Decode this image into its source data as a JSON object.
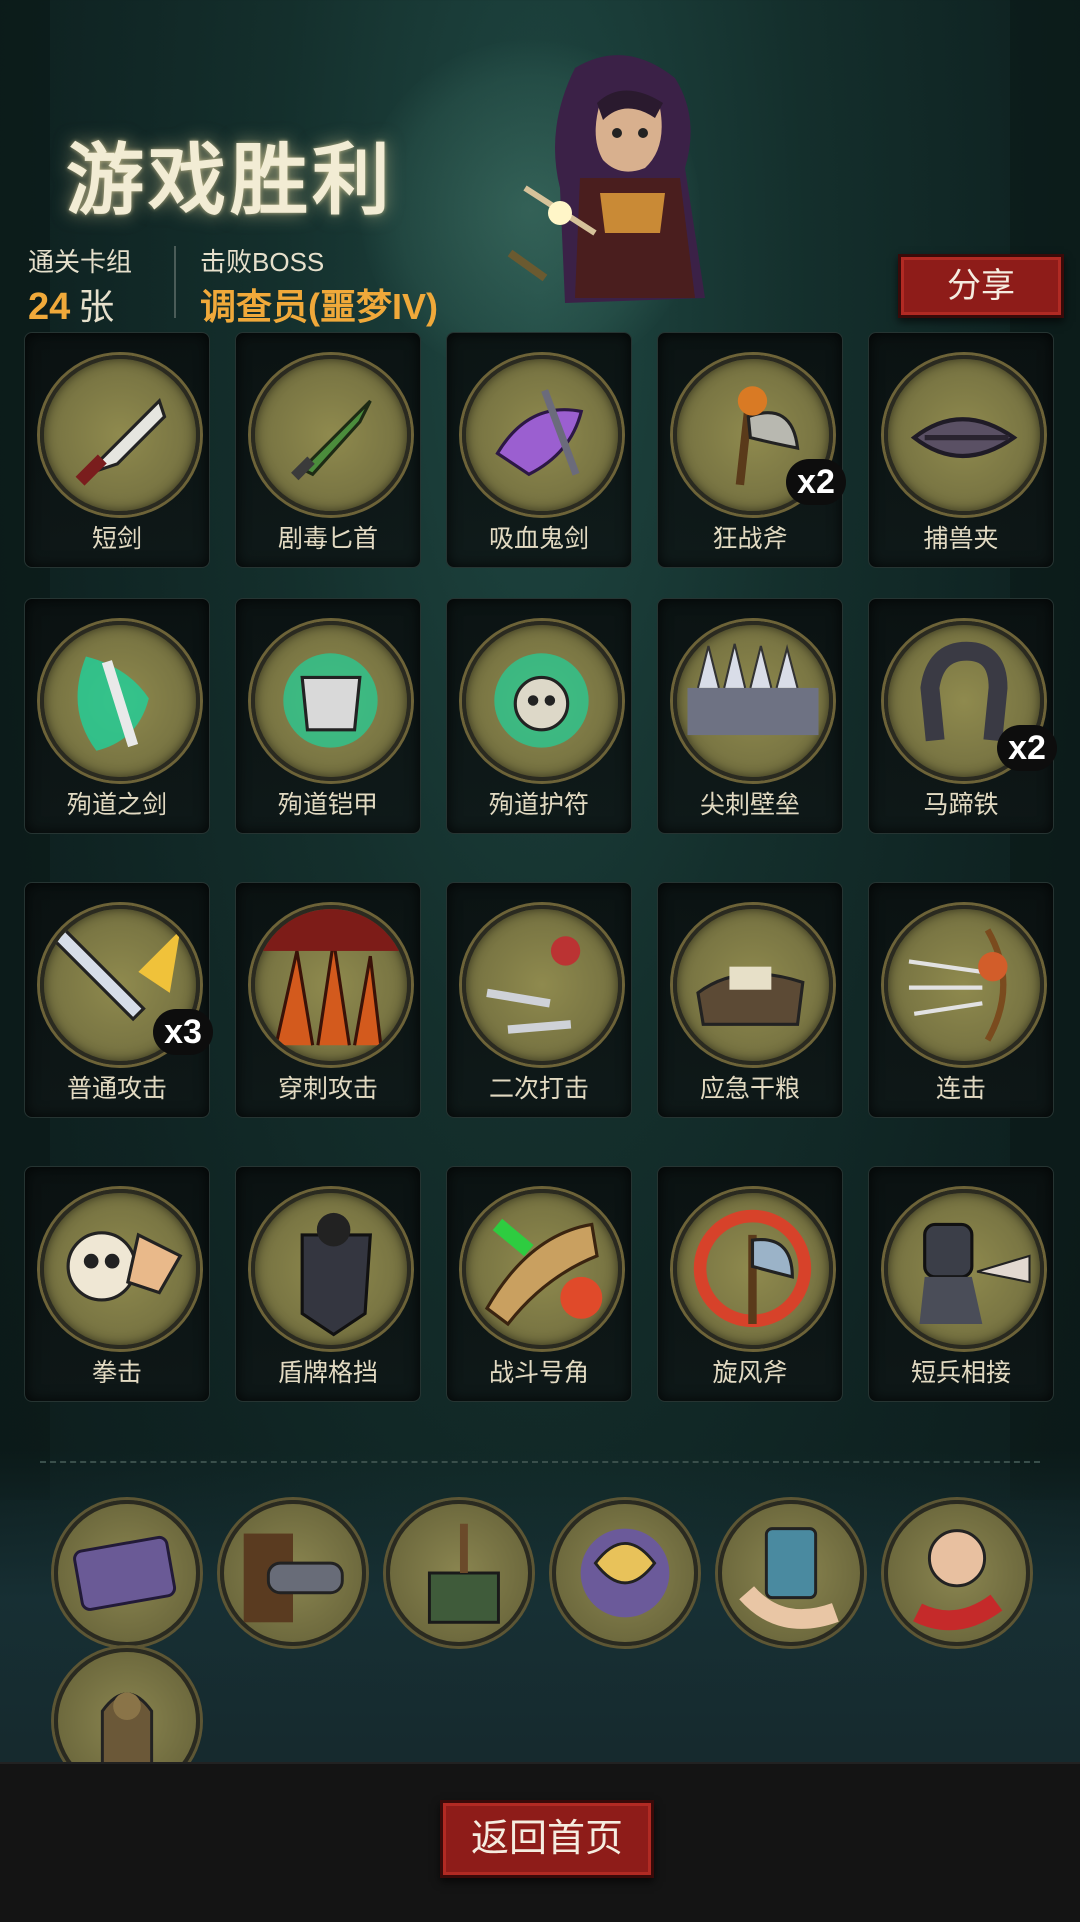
{
  "header": {
    "title": "游戏胜利",
    "cleared_deck_label": "通关卡组",
    "cleared_deck_count": "24",
    "cleared_deck_unit": "张",
    "defeated_boss_label": "击败BOSS",
    "defeated_boss_name": "调查员(噩梦IV)",
    "share_label": "分享"
  },
  "cards": [
    {
      "label": "短剑",
      "icon": "short-sword-icon",
      "count": ""
    },
    {
      "label": "剧毒匕首",
      "icon": "poison-dagger-icon",
      "count": ""
    },
    {
      "label": "吸血鬼剑",
      "icon": "vampire-sword-icon",
      "count": ""
    },
    {
      "label": "狂战斧",
      "icon": "berserker-axe-icon",
      "count": "x2"
    },
    {
      "label": "捕兽夹",
      "icon": "bear-trap-icon",
      "count": ""
    },
    {
      "label": "殉道之剑",
      "icon": "martyr-sword-icon",
      "count": ""
    },
    {
      "label": "殉道铠甲",
      "icon": "martyr-armor-icon",
      "count": ""
    },
    {
      "label": "殉道护符",
      "icon": "martyr-amulet-icon",
      "count": ""
    },
    {
      "label": "尖刺壁垒",
      "icon": "spike-wall-icon",
      "count": ""
    },
    {
      "label": "马蹄铁",
      "icon": "horseshoe-icon",
      "count": "x2"
    },
    {
      "label": "普通攻击",
      "icon": "basic-attack-icon",
      "count": "x3"
    },
    {
      "label": "穿刺攻击",
      "icon": "pierce-attack-icon",
      "count": ""
    },
    {
      "label": "二次打击",
      "icon": "double-strike-icon",
      "count": ""
    },
    {
      "label": "应急干粮",
      "icon": "emergency-rations-icon",
      "count": ""
    },
    {
      "label": "连击",
      "icon": "combo-bow-icon",
      "count": ""
    },
    {
      "label": "拳击",
      "icon": "punch-icon",
      "count": ""
    },
    {
      "label": "盾牌格挡",
      "icon": "shield-block-icon",
      "count": ""
    },
    {
      "label": "战斗号角",
      "icon": "war-horn-icon",
      "count": ""
    },
    {
      "label": "旋风斧",
      "icon": "whirlwind-axe-icon",
      "count": ""
    },
    {
      "label": "短兵相接",
      "icon": "close-combat-icon",
      "count": ""
    }
  ],
  "relics": [
    {
      "icon": "ticket-relic-icon"
    },
    {
      "icon": "cannon-relic-icon"
    },
    {
      "icon": "rank-badge-relic-icon"
    },
    {
      "icon": "beast-relic-icon"
    },
    {
      "icon": "card-hand-relic-icon"
    },
    {
      "icon": "laughing-man-relic-icon"
    },
    {
      "icon": "idol-relic-icon"
    }
  ],
  "footer": {
    "home_label": "返回首页"
  },
  "colors": {
    "accent_orange": "#f0a93a",
    "button_red": "#8e1c19",
    "card_bg": "#0e1616",
    "icon_olive": "#8a854e"
  }
}
